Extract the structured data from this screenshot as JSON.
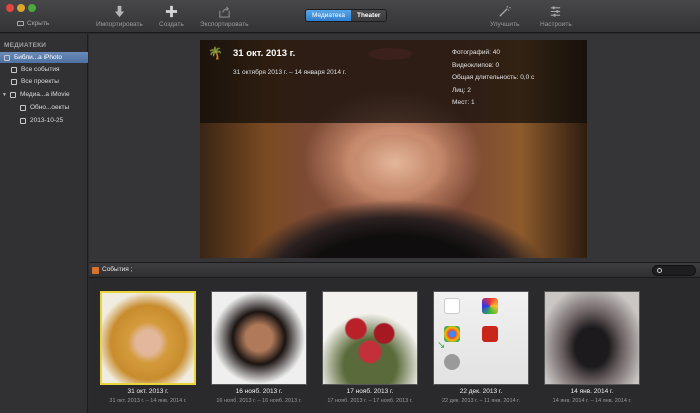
{
  "toolbar": {
    "hide_label": "Скрыть",
    "import_label": "Импортировать",
    "create_label": "Создать",
    "export_label": "Экспортировать",
    "tab_library": "Медиатека",
    "tab_theater": "Theater",
    "enhance_label": "Улучшить",
    "adjust_label": "Настроить"
  },
  "sidebar": {
    "header": "МЕДИАТЕКИ",
    "items": [
      {
        "label": "Библи...а iPhoto",
        "icon": "iphoto-library-icon",
        "selected": true
      },
      {
        "label": "Все события",
        "icon": "events-icon",
        "selected": false
      },
      {
        "label": "Все проекты",
        "icon": "projects-icon",
        "selected": false
      },
      {
        "label": "Медиа...а iMovie",
        "icon": "imovie-library-icon",
        "selected": false
      },
      {
        "label": "Обно...оекты",
        "icon": "folder-icon",
        "selected": false
      },
      {
        "label": "2013-10-25",
        "icon": "event-icon",
        "selected": false
      }
    ]
  },
  "preview": {
    "title": "31 окт. 2013 г.",
    "range": "31 октября 2013 г. – 14 января 2014 г.",
    "stats": [
      "Фотографий: 40",
      "Видеоклипов: 0",
      "Общая длительность: 0,0 с",
      "Лиц: 2",
      "Мест: 1"
    ]
  },
  "events_bar": {
    "label": "События ;"
  },
  "events": [
    {
      "date": "31 окт. 2013 г.",
      "range": "31 окт. 2013 г. – 14 янв. 2014 г.",
      "selected": true
    },
    {
      "date": "16 нояб. 2013 г.",
      "range": "16 нояб. 2013 г. – 16 нояб. 2013 г.",
      "selected": false
    },
    {
      "date": "17 нояб. 2013 г.",
      "range": "17 нояб. 2013 г. – 17 нояб. 2013 г.",
      "selected": false
    },
    {
      "date": "22 дек. 2013 г.",
      "range": "22 дек. 2013 г. – 11 янв. 2014 г.",
      "selected": false
    },
    {
      "date": "14 янв. 2014 г.",
      "range": "14 янв. 2014 г. – 14 янв. 2014 г.",
      "selected": false
    }
  ],
  "colors": {
    "selection_blue": "#5a7bab",
    "tab_active": "#3d8ed9",
    "selected_thumb_border": "#e8d53a"
  }
}
